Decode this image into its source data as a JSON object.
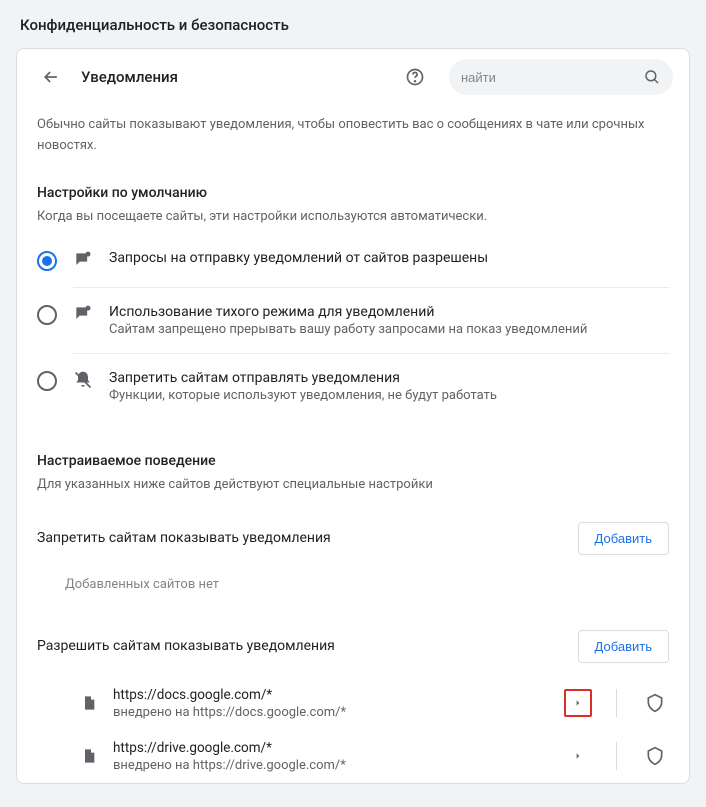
{
  "page": {
    "title": "Конфиденциальность и безопасность"
  },
  "header": {
    "subtitle": "Уведомления",
    "search_placeholder": "найти"
  },
  "intro": "Обычно сайты показывают уведомления, чтобы оповестить вас о сообщениях в чате или срочных новостях.",
  "defaults": {
    "heading": "Настройки по умолчанию",
    "sub": "Когда вы посещаете сайты, эти настройки используются автоматически.",
    "options": [
      {
        "title": "Запросы на отправку уведомлений от сайтов разрешены",
        "desc": ""
      },
      {
        "title": "Использование тихого режима для уведомлений",
        "desc": "Сайтам запрещено прерывать вашу работу запросами на показ уведомлений"
      },
      {
        "title": "Запретить сайтам отправлять уведомления",
        "desc": "Функции, которые используют уведомления, не будут работать"
      }
    ],
    "selected": 0
  },
  "custom": {
    "heading": "Настраиваемое поведение",
    "sub": "Для указанных ниже сайтов действуют специальные настройки"
  },
  "block": {
    "label": "Запретить сайтам показывать уведомления",
    "add": "Добавить",
    "empty": "Добавленных сайтов нет"
  },
  "allow": {
    "label": "Разрешить сайтам показывать уведомления",
    "add": "Добавить",
    "sites": [
      {
        "url": "https://docs.google.com/*",
        "sub": "внедрено на https://docs.google.com/*",
        "highlighted": true
      },
      {
        "url": "https://drive.google.com/*",
        "sub": "внедрено на https://drive.google.com/*",
        "highlighted": false
      }
    ]
  }
}
